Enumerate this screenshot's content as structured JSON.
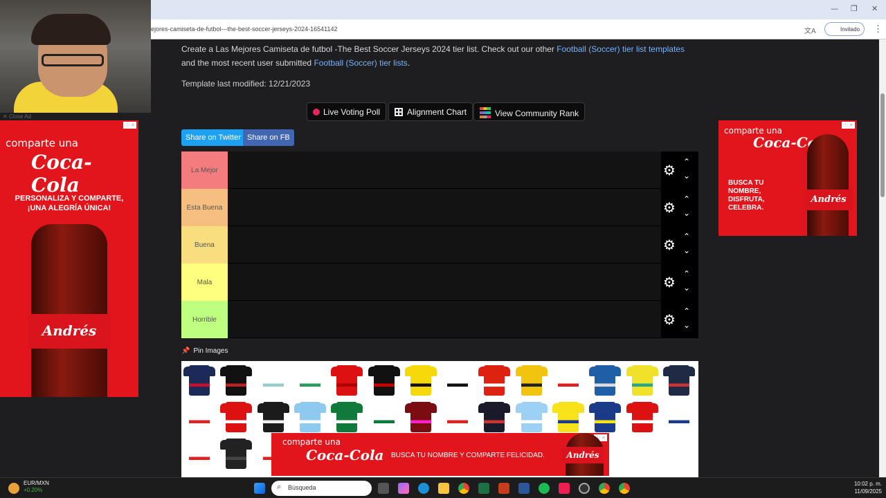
{
  "browser": {
    "url": "ejores-camiseta-de-futbol---the-best-soccer-jerseys-2024-16541142",
    "profile_label": "Invitado",
    "translate_icon": "translate-icon",
    "minimize": "—",
    "restore": "❐",
    "close": "✕"
  },
  "page": {
    "intro_text_1": "Create a Las Mejores Camiseta de futbol -The Best Soccer Jerseys 2024 tier list. Check out our other ",
    "intro_link_1": "Football (Soccer) tier list templates",
    "intro_text_2": " and the most recent user submitted ",
    "intro_link_2": "Football (Soccer) tier lists",
    "intro_text_3": ".",
    "modified": "Template last modified: 12/21/2023",
    "buttons": {
      "live_poll": "Live Voting Poll",
      "alignment": "Alignment Chart",
      "community": "View Community Rank"
    },
    "share": {
      "twitter": "Share on Twitter",
      "fb": "Share on FB"
    },
    "tiers": [
      {
        "label": "La Mejor",
        "color": "#f47c7f"
      },
      {
        "label": "Esta Buena",
        "color": "#f7bf7f"
      },
      {
        "label": "Buena",
        "color": "#f8de7f"
      },
      {
        "label": "Mala",
        "color": "#feff7f"
      },
      {
        "label": "Horrible",
        "color": "#bfff7f"
      }
    ],
    "pin_images": "Pin Images"
  },
  "webcam": {
    "close_ad": "Close Ad"
  },
  "ads": {
    "left": {
      "comparte": "comparte una",
      "brand": "Coca-Cola",
      "tagline": "PERSONALIZA Y COMPARTE, ¡UNA ALEGRÍA ÚNICA!",
      "name": "Andrés"
    },
    "right": {
      "comparte": "comparte una",
      "brand": "Coca-Cola",
      "tagline": "BUSCA TU NOMBRE, DISFRUTA, CELEBRA.",
      "name": "Andrés"
    },
    "bottom": {
      "comparte": "comparte una",
      "brand": "Coca-Cola",
      "tagline": "BUSCA TU NOMBRE Y COMPARTE FELICIDAD.",
      "name": "Andrés"
    }
  },
  "taskbar": {
    "ticker": "EUR/MXN",
    "change": "+0.20%",
    "search_placeholder": "Búsqueda",
    "time": "10:02 p. m.",
    "date": "11/09/2025"
  }
}
